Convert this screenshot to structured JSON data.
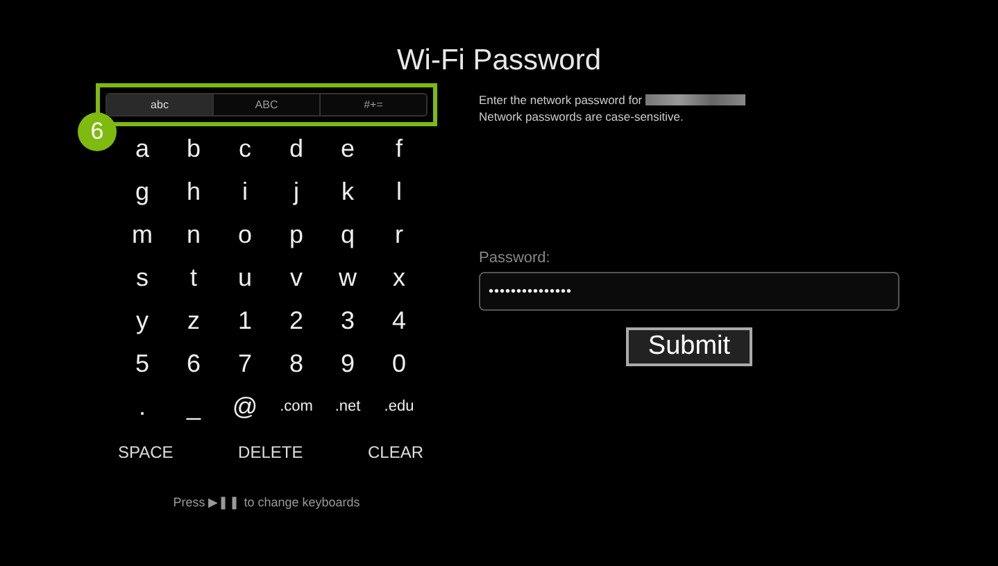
{
  "title": "Wi-Fi Password",
  "keyboard_tabs": [
    {
      "label": "abc",
      "selected": true
    },
    {
      "label": "ABC",
      "selected": false
    },
    {
      "label": "#+=",
      "selected": false
    }
  ],
  "callout": {
    "number": "6"
  },
  "keys": [
    [
      "a",
      "b",
      "c",
      "d",
      "e",
      "f"
    ],
    [
      "g",
      "h",
      "i",
      "j",
      "k",
      "l"
    ],
    [
      "m",
      "n",
      "o",
      "p",
      "q",
      "r"
    ],
    [
      "s",
      "t",
      "u",
      "v",
      "w",
      "x"
    ],
    [
      "y",
      "z",
      "1",
      "2",
      "3",
      "4"
    ],
    [
      "5",
      "6",
      "7",
      "8",
      "9",
      "0"
    ],
    [
      ".",
      "_",
      "@",
      ".com",
      ".net",
      ".edu"
    ]
  ],
  "action_keys": [
    "SPACE",
    "DELETE",
    "CLEAR"
  ],
  "hint": "Press ▶❚❚ to change keyboards",
  "instructions": [
    "Enter the network password for",
    "Network passwords are case-sensitive."
  ],
  "password": {
    "label": "Password:",
    "value": "•••••••••••••••"
  },
  "submit": "Submit"
}
